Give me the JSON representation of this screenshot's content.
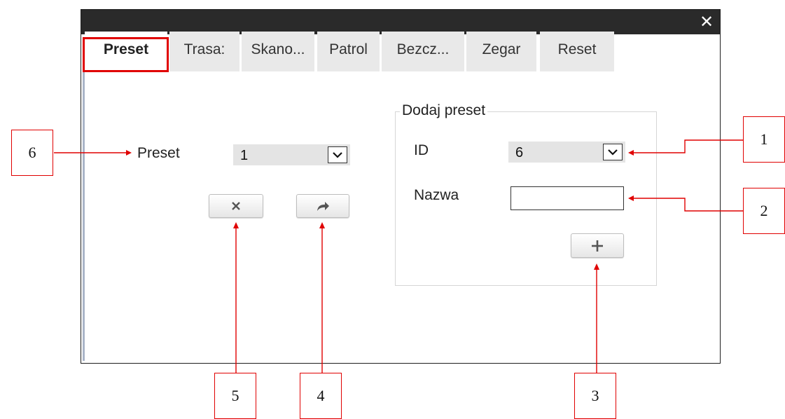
{
  "window": {
    "close_glyph": "✕"
  },
  "tabs": [
    {
      "label": "Preset",
      "active": true
    },
    {
      "label": "Trasa:"
    },
    {
      "label": "Skano..."
    },
    {
      "label": "Patrol"
    },
    {
      "label": "Bezcz..."
    },
    {
      "label": "Zegar"
    },
    {
      "label": "Reset"
    }
  ],
  "preset_panel": {
    "label": "Preset",
    "selected_value": "1",
    "delete_icon": "close-icon",
    "goto_icon": "redo-arrow-icon"
  },
  "add_preset": {
    "legend": "Dodaj preset",
    "id_label": "ID",
    "id_value": "6",
    "name_label": "Nazwa",
    "name_value": "",
    "add_icon": "plus-icon"
  },
  "annotations": {
    "callouts": [
      "1",
      "2",
      "3",
      "4",
      "5",
      "6"
    ],
    "highlight_color": "#e00000"
  }
}
